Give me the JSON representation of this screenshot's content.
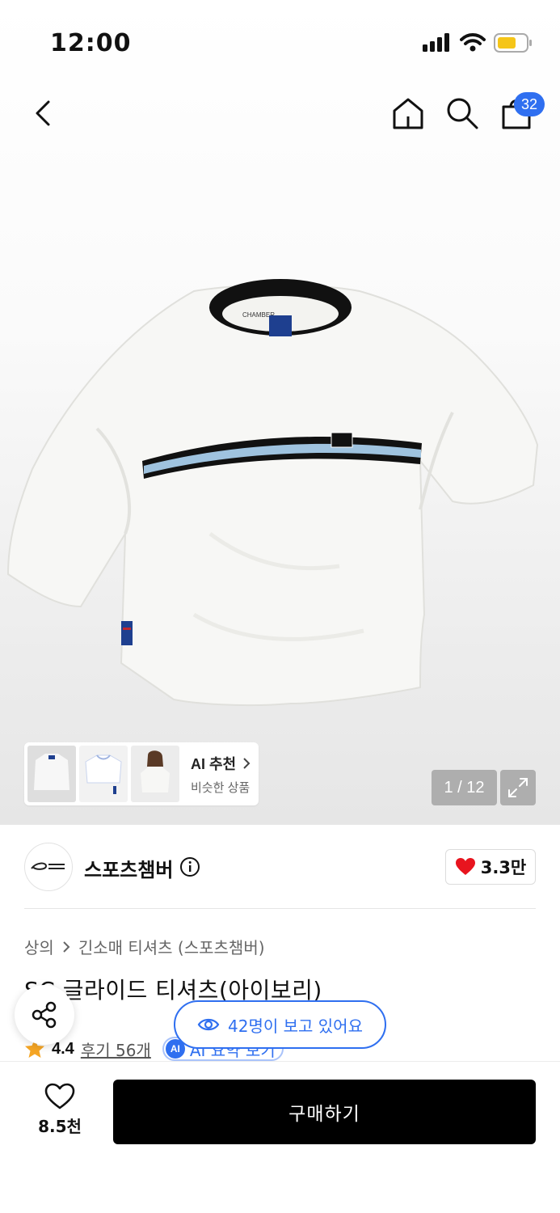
{
  "status_bar": {
    "time": "12:00",
    "battery_color": "#f5c518"
  },
  "nav": {
    "cart_count": "32",
    "accent": "#2f6ff0"
  },
  "gallery": {
    "ai_recommend": {
      "title": "AI 추천",
      "subtitle": "비슷한 상품"
    },
    "page_counter": "1 / 12"
  },
  "brand": {
    "name": "스포츠챔버",
    "like_count": "3.3만",
    "like_color": "#e8141e"
  },
  "product": {
    "breadcrumb": [
      "상의",
      "긴소매 티셔츠 (스포츠챔버)"
    ],
    "title": "SC 글라이드 티셔츠(아이보리)",
    "rating": "4.4",
    "review_label": "후기 56개",
    "ai_summary_badge": "AI",
    "ai_summary_label": "AI 요약 보기"
  },
  "viewers": {
    "label": "42명이 보고 있어요"
  },
  "bottom_bar": {
    "wish_count": "8.5천",
    "buy_label": "구매하기"
  }
}
